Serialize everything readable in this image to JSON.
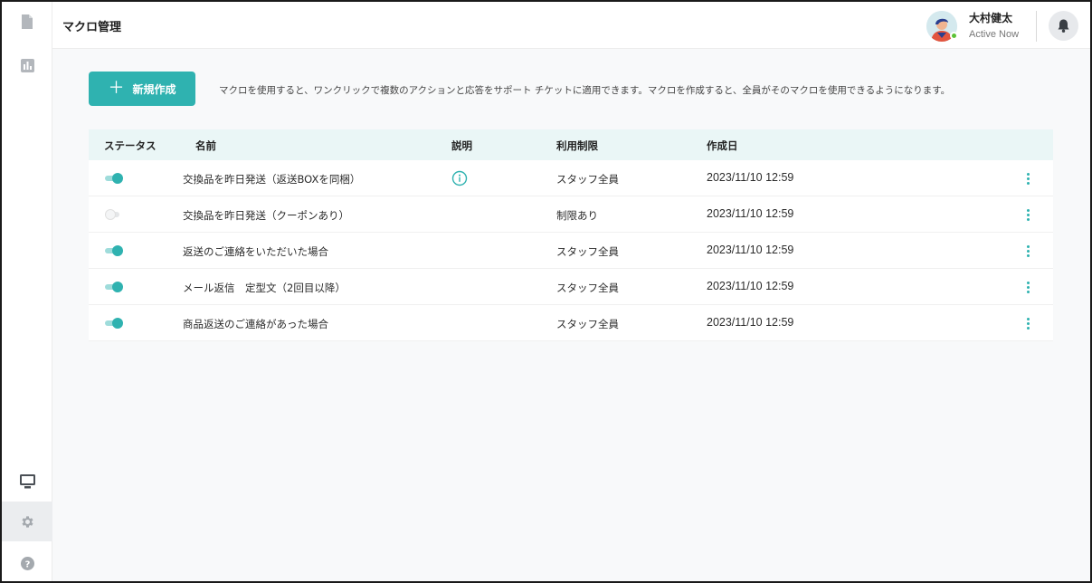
{
  "header": {
    "title": "マクロ管理",
    "user": {
      "name": "大村健太",
      "status": "Active Now"
    }
  },
  "sidebar": {
    "top_icons": [
      "document-icon",
      "chart-icon"
    ],
    "bottom_icons": [
      "monitor-icon",
      "gear-icon",
      "help-icon"
    ],
    "active": "gear-icon"
  },
  "main": {
    "create_button": {
      "label": "新規作成",
      "icon": "plus-icon"
    },
    "description": "マクロを使用すると、ワンクリックで複数のアクションと応答をサポート チケットに適用できます。マクロを作成すると、全員がそのマクロを使用できるようになります。"
  },
  "table": {
    "columns": {
      "status": "ステータス",
      "name": "名前",
      "description": "説明",
      "restriction": "利用制限",
      "created": "作成日"
    },
    "rows": [
      {
        "enabled": true,
        "name": "交換品を昨日発送（返送BOXを同梱）",
        "has_info": true,
        "restriction": "スタッフ全員",
        "created": "2023/11/10 12:59"
      },
      {
        "enabled": false,
        "name": "交換品を昨日発送（クーポンあり）",
        "has_info": false,
        "restriction": "制限あり",
        "created": "2023/11/10 12:59"
      },
      {
        "enabled": true,
        "name": "返送のご連絡をいただいた場合",
        "has_info": false,
        "restriction": "スタッフ全員",
        "created": "2023/11/10 12:59"
      },
      {
        "enabled": true,
        "name": "メール返信　定型文（2回目以降）",
        "has_info": false,
        "restriction": "スタッフ全員",
        "created": "2023/11/10 12:59"
      },
      {
        "enabled": true,
        "name": "商品返送のご連絡があった場合",
        "has_info": false,
        "restriction": "スタッフ全員",
        "created": "2023/11/10 12:59"
      }
    ]
  },
  "colors": {
    "accent": "#2fb2b0",
    "header_row": "#eaf6f6",
    "background": "#f8f9fa"
  }
}
